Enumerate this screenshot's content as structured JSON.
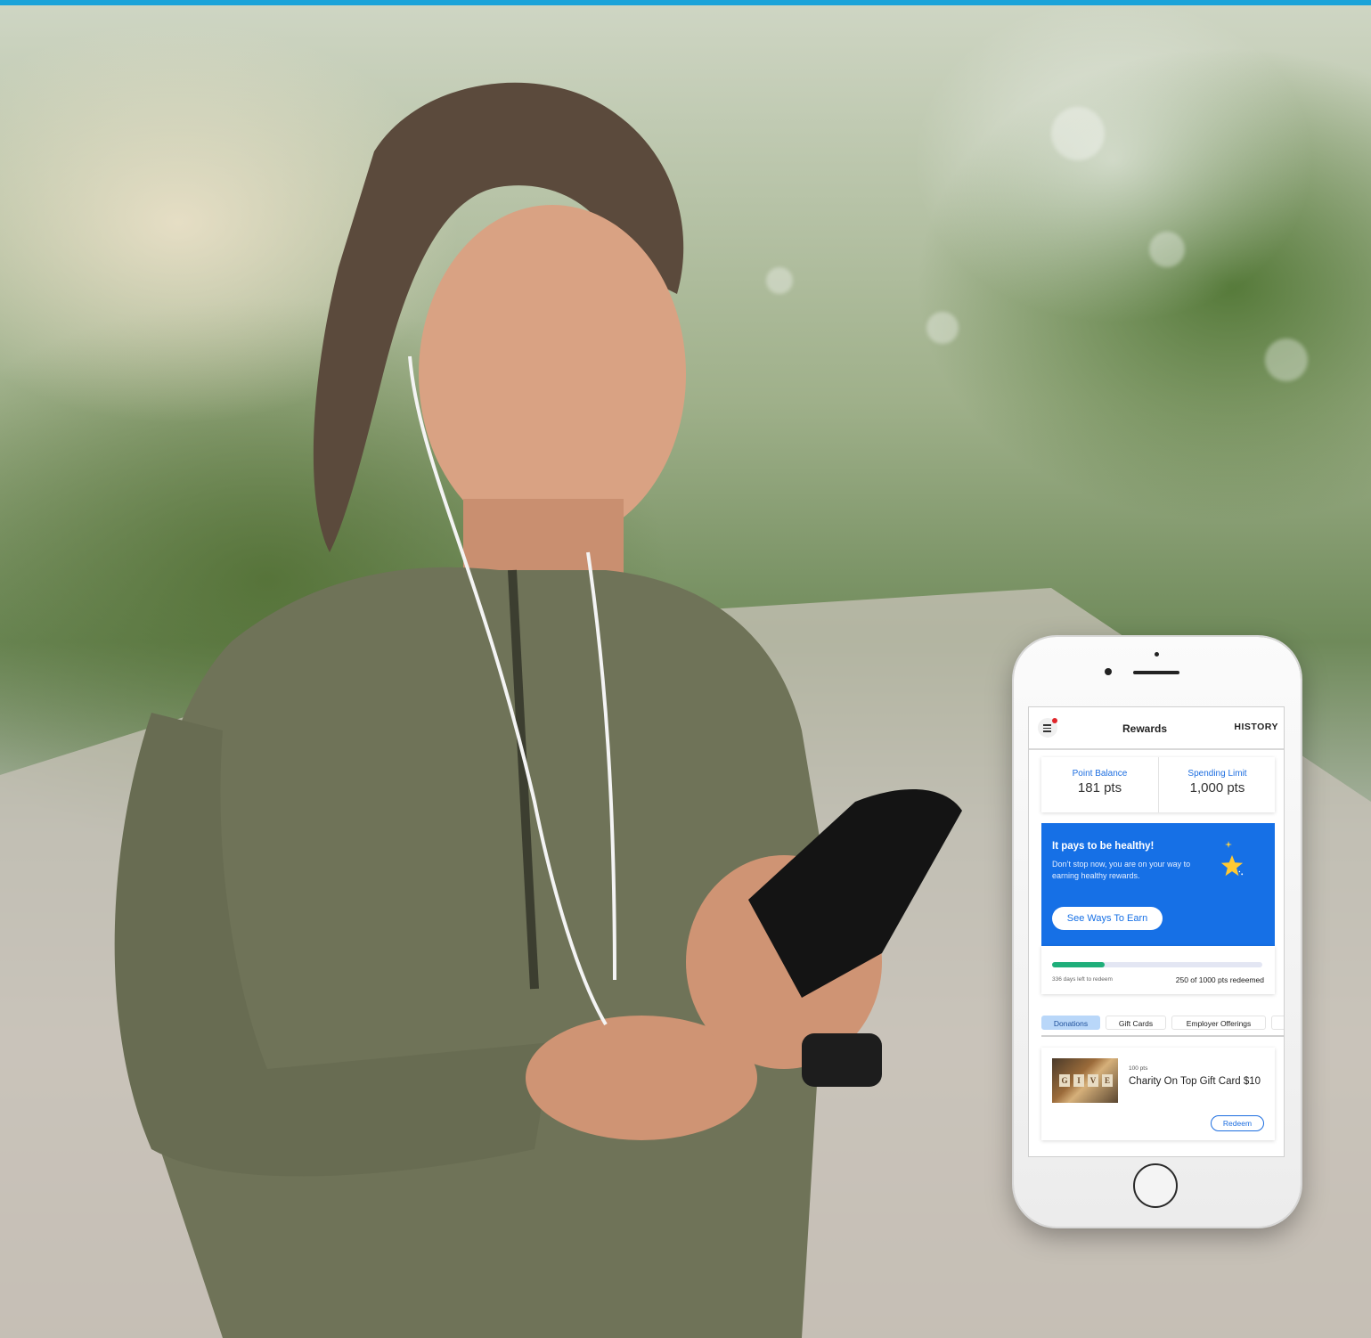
{
  "app": {
    "title": "Rewards",
    "history_label": "HISTORY"
  },
  "balance": {
    "point_balance_label": "Point Balance",
    "point_balance_value": "181 pts",
    "spending_limit_label": "Spending Limit",
    "spending_limit_value": "1,000 pts"
  },
  "promo": {
    "title": "It pays to be healthy!",
    "text": "Don’t stop now, you are on your way to earning healthy rewards.",
    "button_label": "See Ways To Earn"
  },
  "progress": {
    "fraction": 0.25,
    "days_left": "336 days left to redeem",
    "redeemed": "250 of 1000 pts redeemed"
  },
  "tabs": [
    {
      "label": "Donations",
      "active": true
    },
    {
      "label": "Gift Cards",
      "active": false
    },
    {
      "label": "Employer Offerings",
      "active": false
    }
  ],
  "reward": {
    "points": "100 pts",
    "title": "Charity On Top Gift Card $10",
    "image_text": "GIVE",
    "redeem_label": "Redeem"
  },
  "colors": {
    "accent_bar": "#1aa3d9",
    "primary_blue": "#1670e6",
    "progress_green": "#1fae7a",
    "notification_red": "#e0262b"
  }
}
